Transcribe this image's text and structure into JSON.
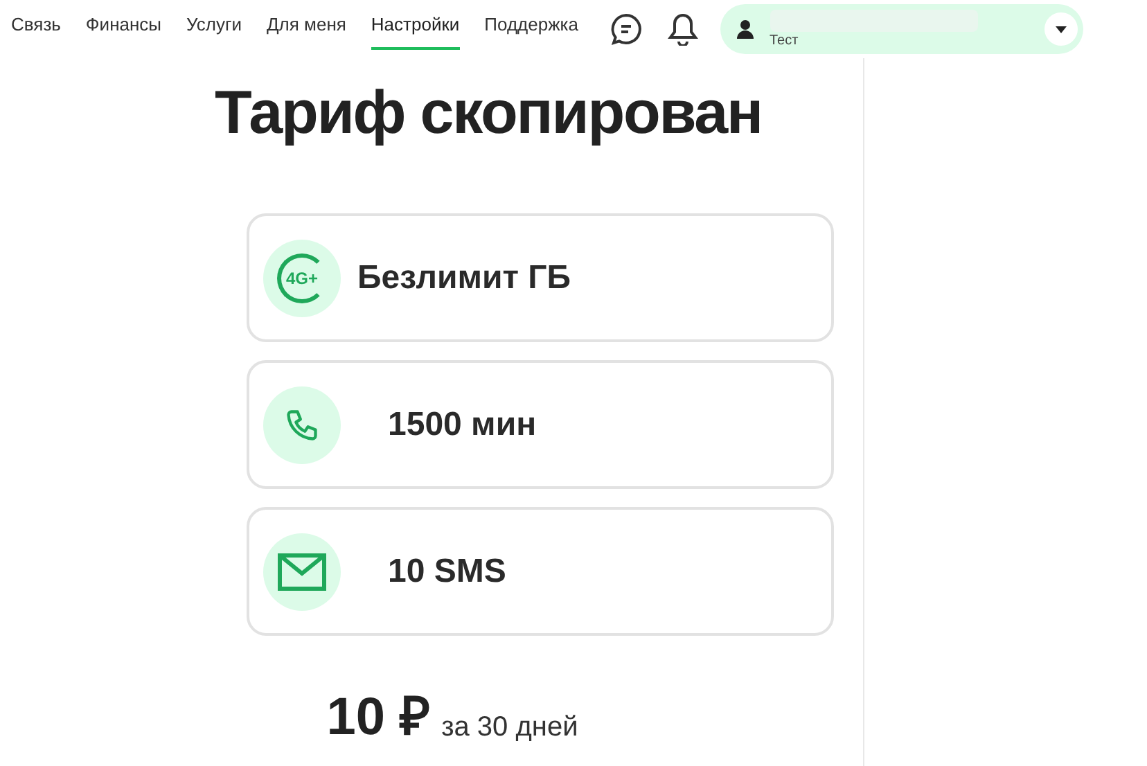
{
  "nav": {
    "items": [
      {
        "label": "Связь",
        "selected": false
      },
      {
        "label": "Финансы",
        "selected": false
      },
      {
        "label": "Услуги",
        "selected": false
      },
      {
        "label": "Для меня",
        "selected": false
      },
      {
        "label": "Настройки",
        "selected": true
      },
      {
        "label": "Поддержка",
        "selected": false
      }
    ]
  },
  "account": {
    "subtitle": "Тест"
  },
  "title": "Тариф скопирован",
  "features": [
    {
      "kind": "data",
      "icon_text": "4G+",
      "label": "Безлимит ГБ"
    },
    {
      "kind": "calls",
      "label": "1500 мин"
    },
    {
      "kind": "sms",
      "label": "10 SMS"
    }
  ],
  "price": {
    "amount": "10 ₽",
    "period": "за 30 дней"
  }
}
